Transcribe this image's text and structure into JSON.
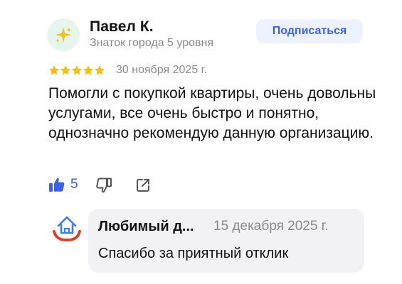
{
  "author": {
    "name": "Павел К.",
    "subtitle": "Знаток города 5 уровня",
    "avatar_icon": "sparkles-icon"
  },
  "subscribe_button": {
    "label": "Подписаться"
  },
  "review": {
    "rating": 5,
    "rating_max": 5,
    "date": "30 ноября 2025 г.",
    "text": "Помогли с покупкой квартиры, очень довольны услугами, все очень быстро и понятно, однозначно рекомендую данную организацию."
  },
  "actions": {
    "like_icon": "thumbs-up-icon",
    "like_count": "5",
    "dislike_icon": "thumbs-down-icon",
    "share_icon": "share-icon"
  },
  "reply": {
    "org_icon": "house-hands-icon",
    "org_name": "Любимый д...",
    "date": "15 декабря 2025 г.",
    "text": "Спасибо за приятный отклик"
  },
  "colors": {
    "accent_blue": "#3a62e8",
    "star_gold": "#f7c000",
    "muted_text": "#8a8a8a",
    "subscribe_bg": "#eef2ff",
    "reply_bg": "#f2f2f4",
    "org_logo_red": "#d9402b",
    "org_logo_blue": "#3d7fd8"
  }
}
